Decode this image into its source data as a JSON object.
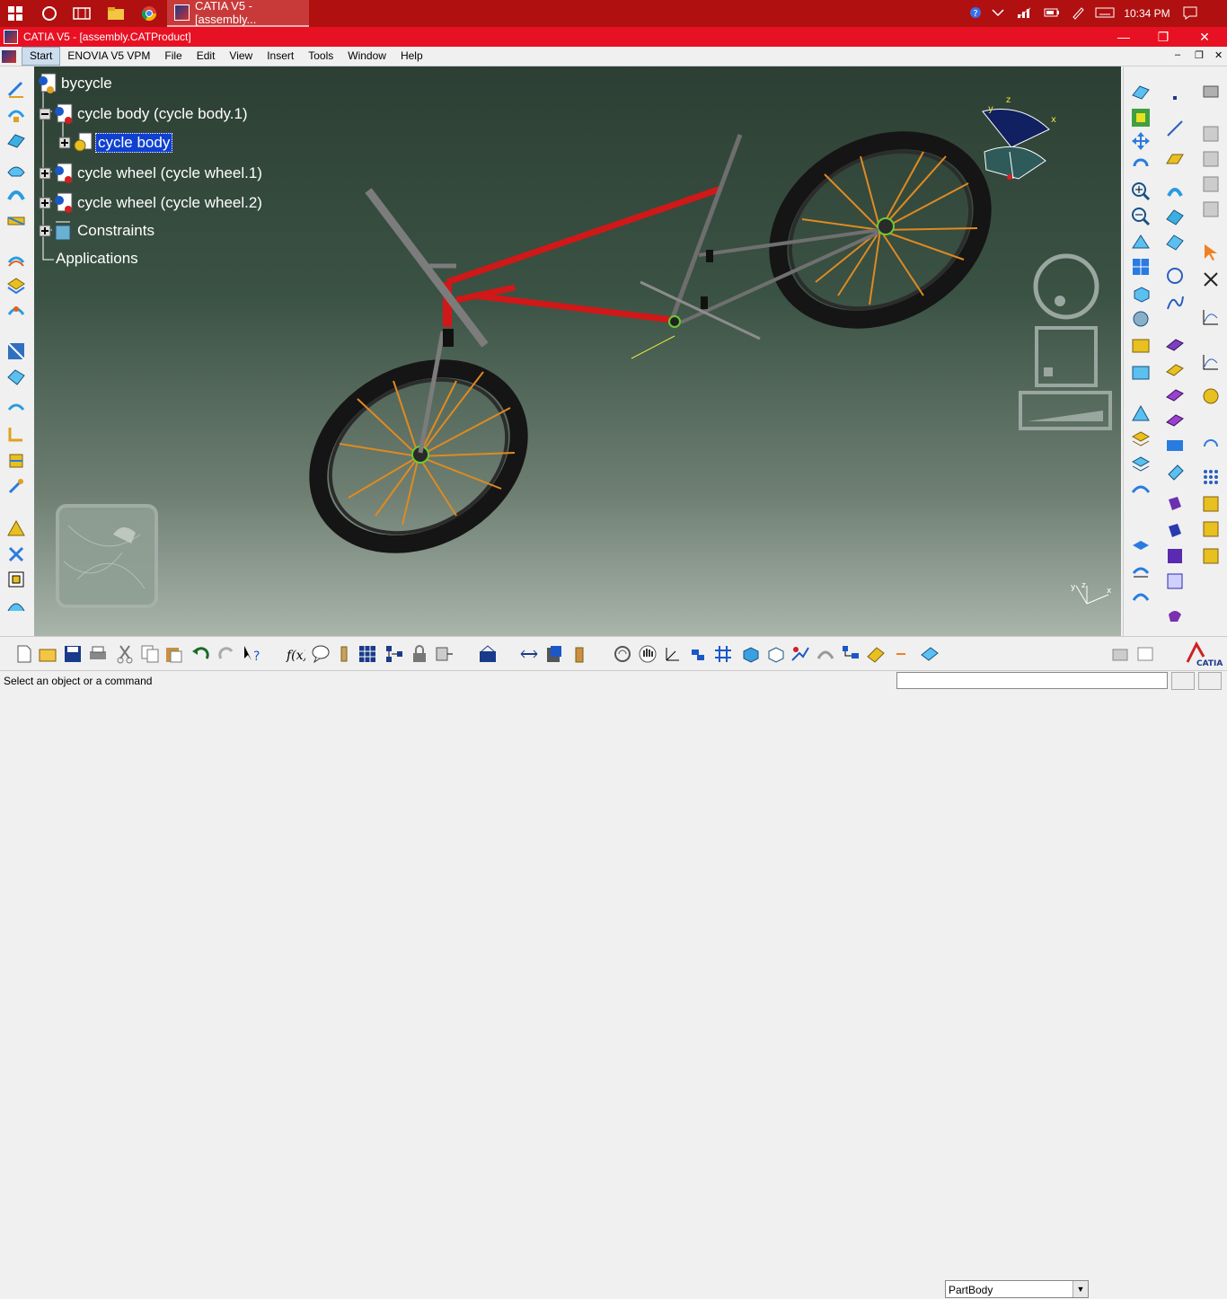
{
  "taskbar": {
    "app_title": "CATIA V5 - [assembly...",
    "time": "10:34 PM"
  },
  "window": {
    "title": "CATIA V5 - [assembly.CATProduct]",
    "minimize": "—",
    "restore": "❐",
    "close": "✕"
  },
  "menu": {
    "items": [
      "Start",
      "ENOVIA V5 VPM",
      "File",
      "Edit",
      "View",
      "Insert",
      "Tools",
      "Window",
      "Help"
    ]
  },
  "tree": {
    "root": "bycycle",
    "n1": "cycle body (cycle body.1)",
    "n2": "cycle body",
    "n3": "cycle wheel (cycle wheel.1)",
    "n4": "cycle wheel (cycle wheel.2)",
    "n5": "Constraints",
    "n6": "Applications"
  },
  "toolbar": {
    "body_select": "PartBody"
  },
  "status": {
    "message": "Select an object or a command"
  },
  "colors": {
    "taskbar": "#b01010",
    "titlebar": "#e81123",
    "frame": "#d01818",
    "selection": "#1040d0"
  }
}
